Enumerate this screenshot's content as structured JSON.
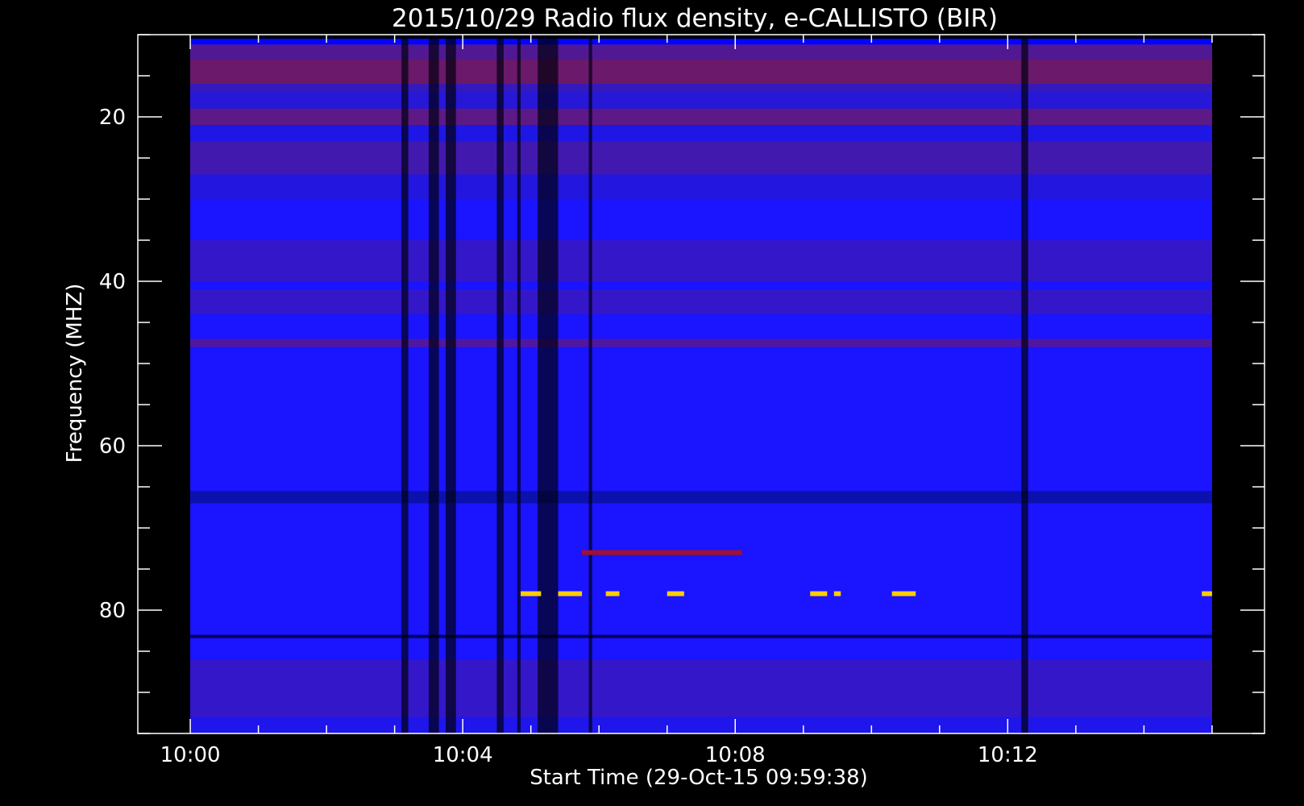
{
  "chart_data": {
    "type": "heatmap",
    "title": "2015/10/29  Radio flux density, e-CALLISTO (BIR)",
    "xlabel": "Start Time (29-Oct-15 09:59:38)",
    "ylabel": "Frequency (MHZ)",
    "x_unit": "minutes after 10:00",
    "xlim": [
      -0.77,
      15.77
    ],
    "ylim": [
      95,
      10
    ],
    "data_xlim": [
      0,
      15
    ],
    "data_ylim": [
      10.5,
      95
    ],
    "x_ticks": [
      {
        "value": 0,
        "label": "10:00"
      },
      {
        "value": 4,
        "label": "10:04"
      },
      {
        "value": 8,
        "label": "10:08"
      },
      {
        "value": 12,
        "label": "10:12"
      }
    ],
    "x_minor_ticks": [
      1,
      2,
      3,
      5,
      6,
      7,
      9,
      10,
      11,
      13,
      14,
      15
    ],
    "y_ticks": [
      {
        "value": 20,
        "label": "20"
      },
      {
        "value": 40,
        "label": "40"
      },
      {
        "value": 60,
        "label": "60"
      },
      {
        "value": 80,
        "label": "80"
      }
    ],
    "y_minor_ticks": [
      10,
      15,
      25,
      30,
      35,
      45,
      50,
      55,
      65,
      70,
      75,
      85,
      90,
      95
    ],
    "colormap": [
      "#000000",
      "#0000ff",
      "#7a1238",
      "#ff2200",
      "#ffcc00"
    ],
    "background_color": "#1a14ff",
    "rfi_bands_mhz": [
      {
        "y0": 10.5,
        "y1": 11.2,
        "color": "#0000ff"
      },
      {
        "y0": 11.2,
        "y1": 13,
        "color": "#5a1a80"
      },
      {
        "y0": 13,
        "y1": 16,
        "color": "#7a1a50"
      },
      {
        "y0": 16,
        "y1": 17,
        "color": "#3a1ab0"
      },
      {
        "y0": 17,
        "y1": 19,
        "color": "#2a18d0"
      },
      {
        "y0": 19,
        "y1": 21,
        "color": "#6a1a70"
      },
      {
        "y0": 21,
        "y1": 23,
        "color": "#2016e0"
      },
      {
        "y0": 23,
        "y1": 27,
        "color": "#4a1aa0"
      },
      {
        "y0": 27,
        "y1": 30,
        "color": "#2616d8"
      },
      {
        "y0": 35,
        "y1": 40,
        "color": "#3a18c0"
      },
      {
        "y0": 41,
        "y1": 44,
        "color": "#3a18c0"
      },
      {
        "y0": 47,
        "y1": 48,
        "color": "#5a1890"
      },
      {
        "y0": 65.5,
        "y1": 67,
        "color": "#0a10a0"
      },
      {
        "y0": 83,
        "y1": 83.4,
        "color": "#000040"
      },
      {
        "y0": 86,
        "y1": 93,
        "color": "#3a18c0"
      },
      {
        "y0": 93,
        "y1": 95,
        "color": "#2016e8"
      }
    ],
    "dark_time_columns_min": [
      {
        "x0": 3.1,
        "x1": 3.2
      },
      {
        "x0": 3.5,
        "x1": 3.65
      },
      {
        "x0": 3.75,
        "x1": 3.9
      },
      {
        "x0": 4.5,
        "x1": 4.6
      },
      {
        "x0": 4.8,
        "x1": 4.85
      },
      {
        "x0": 5.1,
        "x1": 5.4
      },
      {
        "x0": 5.85,
        "x1": 5.9
      },
      {
        "x0": 12.2,
        "x1": 12.3
      }
    ],
    "bursts": [
      {
        "x0": 4.85,
        "x1": 5.15,
        "freq_mhz": 78,
        "color": "#ffcc00"
      },
      {
        "x0": 5.4,
        "x1": 5.75,
        "freq_mhz": 78,
        "color": "#ffcc00"
      },
      {
        "x0": 6.1,
        "x1": 6.3,
        "freq_mhz": 78,
        "color": "#ffcc00"
      },
      {
        "x0": 7.0,
        "x1": 7.25,
        "freq_mhz": 78,
        "color": "#ffcc00"
      },
      {
        "x0": 9.1,
        "x1": 9.35,
        "freq_mhz": 78,
        "color": "#ffcc00"
      },
      {
        "x0": 9.45,
        "x1": 9.55,
        "freq_mhz": 78,
        "color": "#ffcc00"
      },
      {
        "x0": 10.3,
        "x1": 10.65,
        "freq_mhz": 78,
        "color": "#ffcc00"
      },
      {
        "x0": 14.85,
        "x1": 15.0,
        "freq_mhz": 78,
        "color": "#ffcc00"
      },
      {
        "x0": 5.75,
        "x1": 8.1,
        "freq_mhz": 73,
        "color": "#a01030"
      }
    ]
  }
}
